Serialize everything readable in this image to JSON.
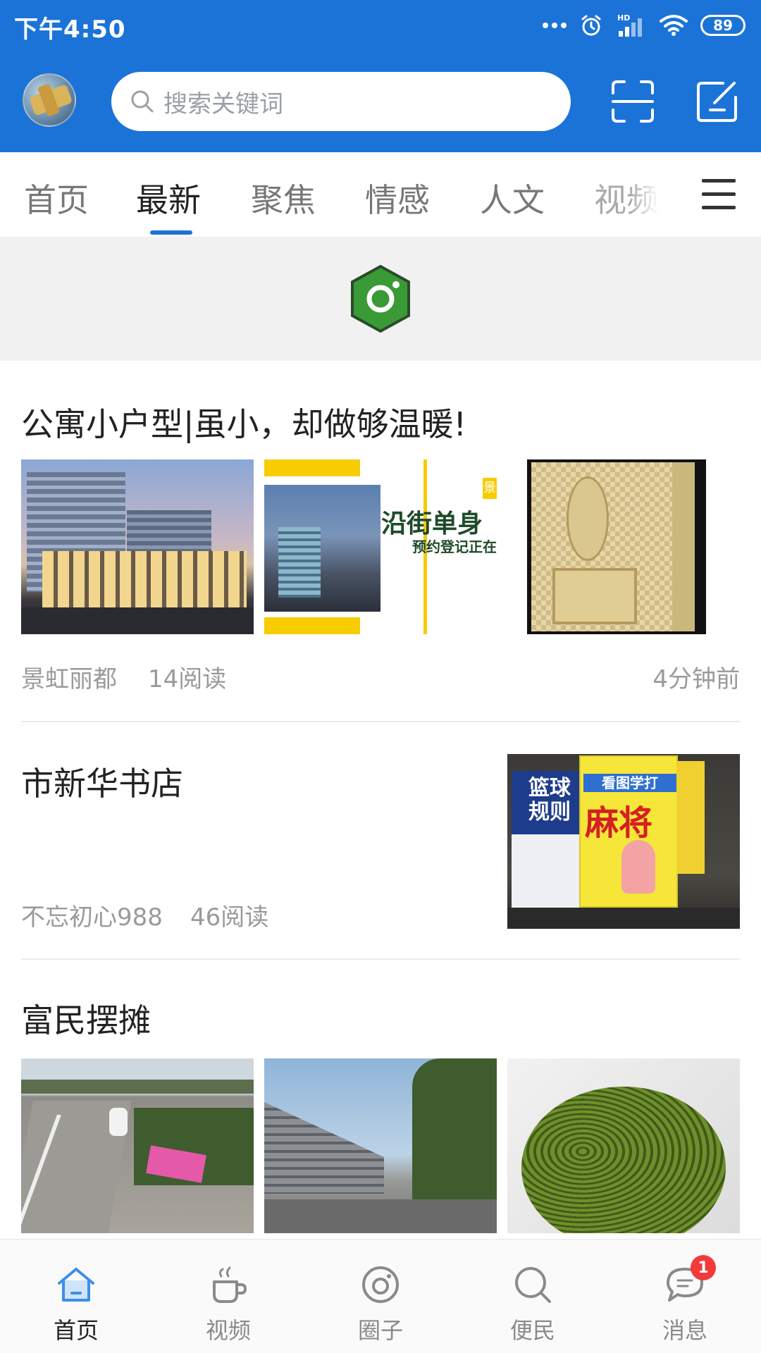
{
  "status_bar": {
    "time": "下午4:50",
    "battery": "89",
    "network": "HD"
  },
  "header": {
    "search_placeholder": "搜索关键词"
  },
  "tabs": [
    {
      "label": "首页"
    },
    {
      "label": "最新"
    },
    {
      "label": "聚焦"
    },
    {
      "label": "情感"
    },
    {
      "label": "人文"
    },
    {
      "label": "视频"
    }
  ],
  "active_tab": "最新",
  "feed": [
    {
      "title": "公寓小户型|虽小，却做够温暖!",
      "author": "景虹丽都",
      "reads": "14阅读",
      "time": "4分钟前",
      "image_texts": {
        "headline": "沿街单身",
        "subline": "预约登记正在",
        "tag": "景"
      }
    },
    {
      "title": "市新华书店",
      "author": "不忘初心988",
      "reads": "46阅读",
      "image_texts": {
        "book1_title": "篮球规则",
        "book2_header": "看图学打",
        "book2_title": "麻将"
      }
    },
    {
      "title": "富民摆摊"
    }
  ],
  "bottom_nav": [
    {
      "label": "首页"
    },
    {
      "label": "视频"
    },
    {
      "label": "圈子"
    },
    {
      "label": "便民"
    },
    {
      "label": "消息",
      "badge": "1"
    }
  ],
  "colors": {
    "brand": "#1b73d8",
    "badge": "#f23a3a",
    "refresh_icon": "#3a9a35"
  }
}
